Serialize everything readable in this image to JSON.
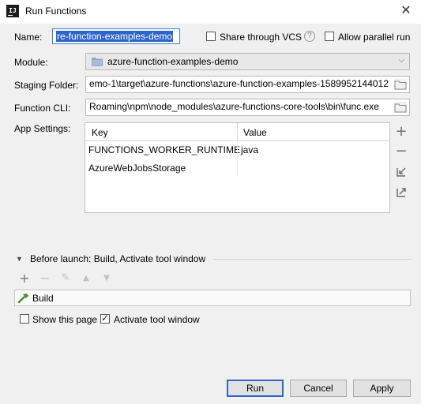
{
  "window": {
    "title": "Run Functions",
    "app_icon_text": "IJ",
    "close_glyph": "✕"
  },
  "form": {
    "name_label": "Name:",
    "name_value": "re-function-examples-demo",
    "share_vcs_label": "Share through VCS",
    "share_vcs_checked": false,
    "help_glyph": "?",
    "allow_parallel_label": "Allow parallel run",
    "allow_parallel_checked": false,
    "module_label": "Module:",
    "module_value": "azure-function-examples-demo",
    "staging_label": "Staging Folder:",
    "staging_value": "emo-1\\target\\azure-functions\\azure-function-examples-1589952144012",
    "cli_label": "Function CLI:",
    "cli_value": "Roaming\\npm\\node_modules\\azure-functions-core-tools\\bin\\func.exe",
    "app_settings_label": "App Settings:"
  },
  "app_settings": {
    "columns": [
      "Key",
      "Value"
    ],
    "rows": [
      {
        "key": "FUNCTIONS_WORKER_RUNTIME",
        "value": "java"
      },
      {
        "key": "AzureWebJobsStorage",
        "value": ""
      }
    ],
    "tools": [
      "plus-icon",
      "minus-icon",
      "import-icon",
      "export-icon"
    ]
  },
  "before_launch": {
    "title": "Before launch: Build, Activate tool window",
    "tasks": [
      {
        "label": "Build",
        "icon": "hammer-icon"
      }
    ],
    "show_page_label": "Show this page",
    "show_page_checked": false,
    "activate_label": "Activate tool window",
    "activate_checked": true
  },
  "buttons": {
    "run": "Run",
    "cancel": "Cancel",
    "apply": "Apply"
  },
  "colors": {
    "selection": "#2f65ca",
    "default_button_border": "#2e67c7",
    "window_bg": "#f0f0f0"
  }
}
